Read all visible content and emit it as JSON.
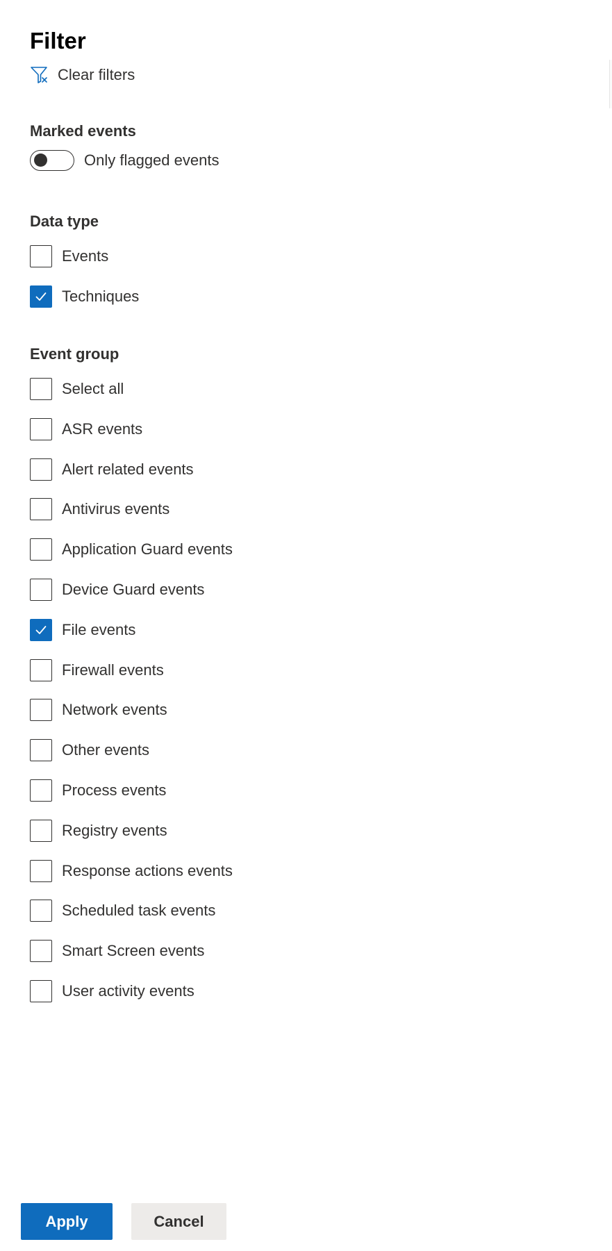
{
  "panel": {
    "title": "Filter",
    "clear_filters_label": "Clear filters"
  },
  "marked_events": {
    "label": "Marked events",
    "toggle": {
      "label": "Only flagged events",
      "on": false
    }
  },
  "data_type": {
    "label": "Data type",
    "options": [
      {
        "label": "Events",
        "checked": false
      },
      {
        "label": "Techniques",
        "checked": true
      }
    ]
  },
  "event_group": {
    "label": "Event group",
    "options": [
      {
        "label": "Select all",
        "checked": false
      },
      {
        "label": "ASR events",
        "checked": false
      },
      {
        "label": "Alert related events",
        "checked": false
      },
      {
        "label": "Antivirus events",
        "checked": false
      },
      {
        "label": "Application Guard events",
        "checked": false
      },
      {
        "label": "Device Guard events",
        "checked": false
      },
      {
        "label": "File events",
        "checked": true
      },
      {
        "label": "Firewall events",
        "checked": false
      },
      {
        "label": "Network events",
        "checked": false
      },
      {
        "label": "Other events",
        "checked": false
      },
      {
        "label": "Process events",
        "checked": false
      },
      {
        "label": "Registry events",
        "checked": false
      },
      {
        "label": "Response actions events",
        "checked": false
      },
      {
        "label": "Scheduled task events",
        "checked": false
      },
      {
        "label": "Smart Screen events",
        "checked": false
      },
      {
        "label": "User activity events",
        "checked": false
      }
    ]
  },
  "footer": {
    "apply_label": "Apply",
    "cancel_label": "Cancel"
  },
  "colors": {
    "accent": "#0f6cbd",
    "text": "#323130",
    "cancel_bg": "#edebe9"
  },
  "icons": {
    "clear_filters": "filter-clear-icon",
    "checkmark": "checkmark-icon"
  }
}
